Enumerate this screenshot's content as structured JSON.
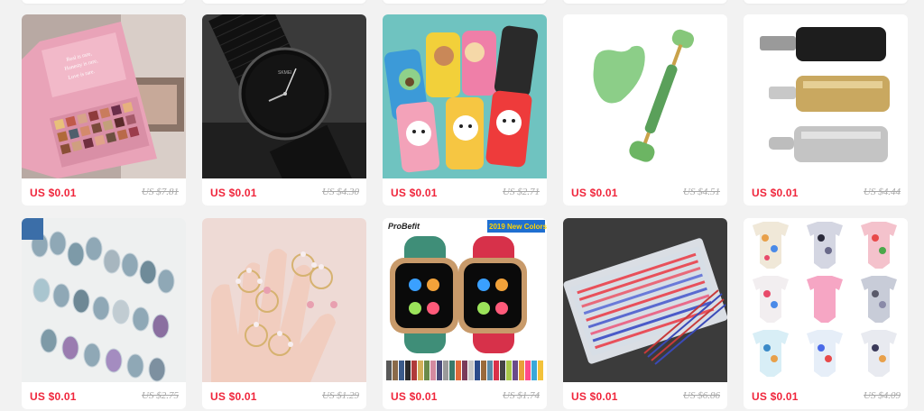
{
  "products": [
    {
      "name_icon": "eyeshadow-palette",
      "price": "US $0.01",
      "original_price": "US $7.81"
    },
    {
      "name_icon": "black-wristwatch",
      "price": "US $0.01",
      "original_price": "US $4.30"
    },
    {
      "name_icon": "phone-cases",
      "price": "US $0.01",
      "original_price": "US $2.71"
    },
    {
      "name_icon": "jade-roller",
      "price": "US $0.01",
      "original_price": "US $4.51"
    },
    {
      "name_icon": "magnetic-adapters",
      "price": "US $0.01",
      "original_price": "US $4.44"
    },
    {
      "name_icon": "crystal-beads",
      "price": "US $0.01",
      "original_price": "US $2.75"
    },
    {
      "name_icon": "flower-earrings",
      "price": "US $0.01",
      "original_price": "US $1.29"
    },
    {
      "name_icon": "smartwatch-bands",
      "price": "US $0.01",
      "original_price": "US $1.74",
      "overlay_text": {
        "brand": "ProBefit",
        "banner": "2019 New Colors"
      }
    },
    {
      "name_icon": "gel-pen-refills",
      "price": "US $0.01",
      "original_price": "US $6.86"
    },
    {
      "name_icon": "baby-bodysuits",
      "price": "US $0.01",
      "original_price": "US $4.09"
    }
  ],
  "colors": {
    "price": "#f0263c",
    "original_price": "#a8a8a8",
    "background": "#f2f2f2",
    "card": "#ffffff"
  }
}
